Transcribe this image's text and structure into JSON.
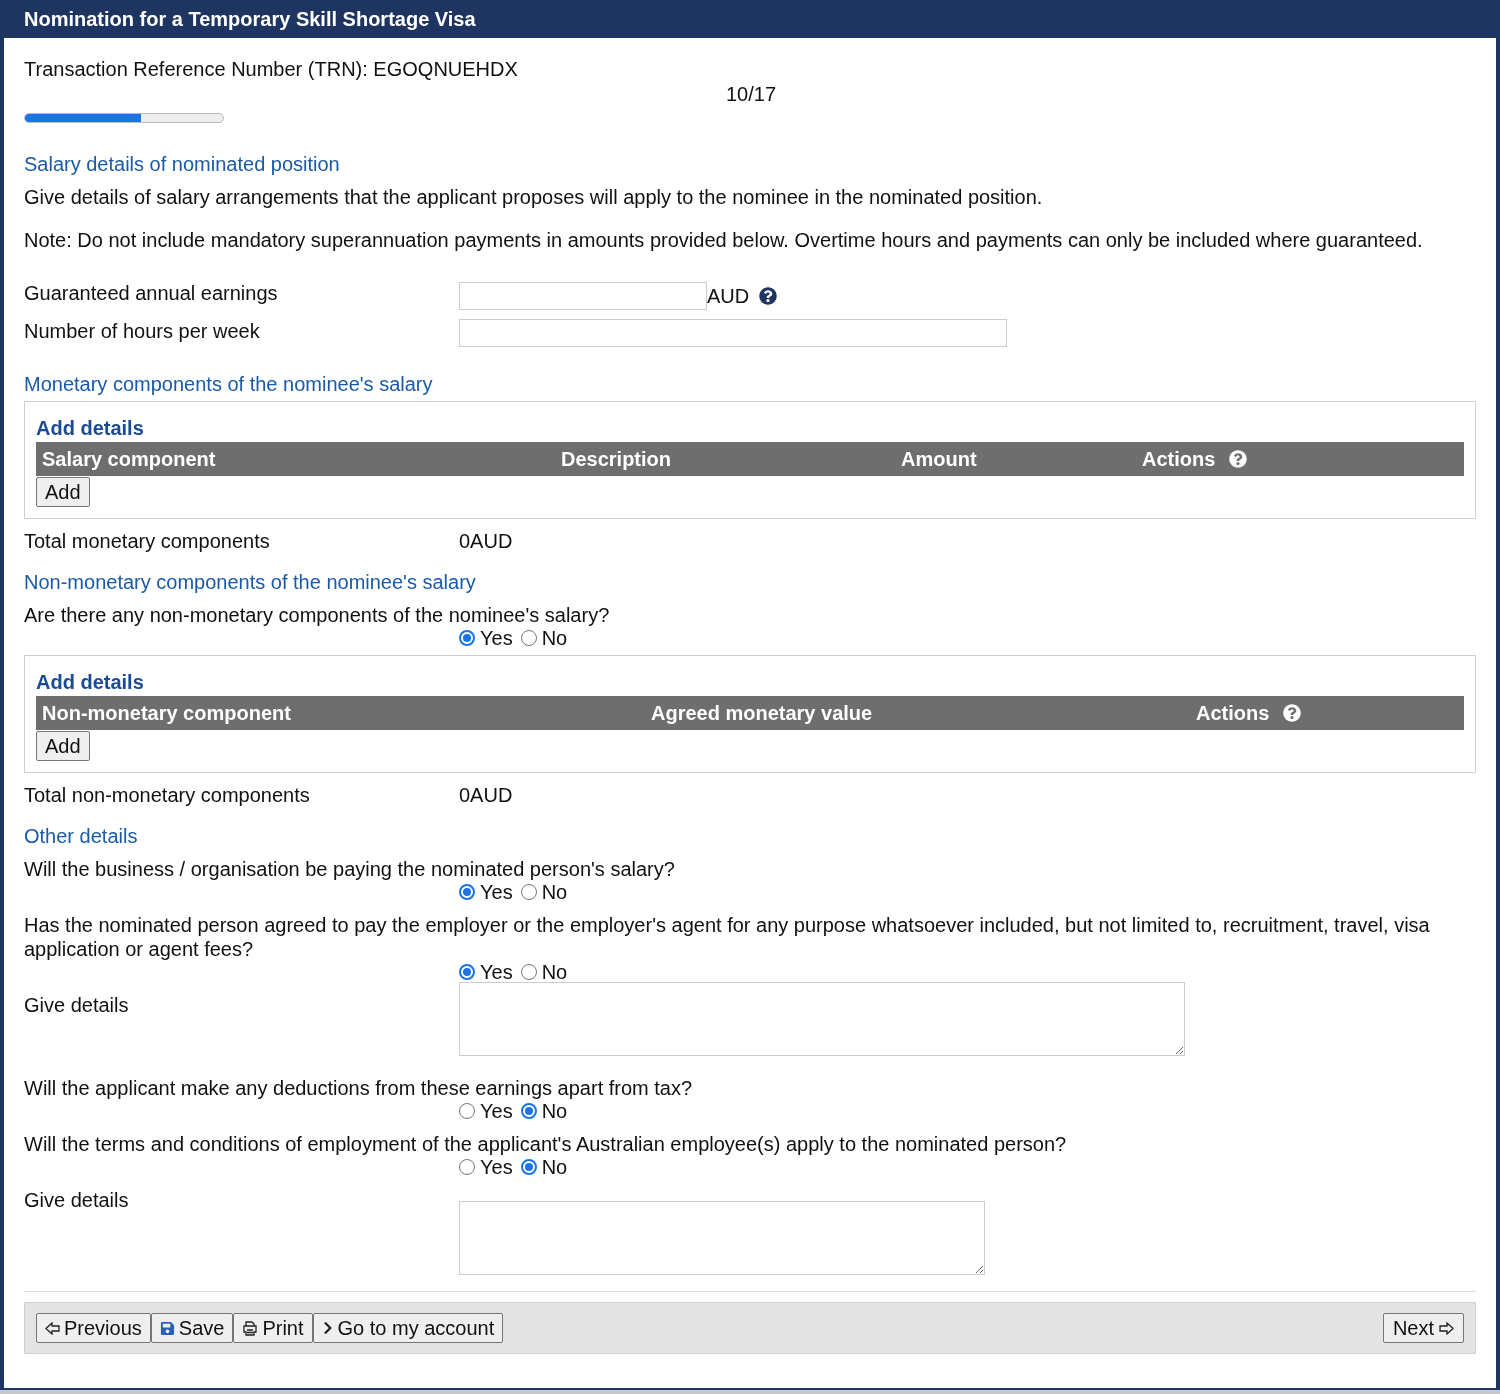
{
  "header": {
    "title": "Nomination for a Temporary Skill Shortage Visa"
  },
  "trn": "Transaction Reference Number (TRN): EGOQNUEHDX",
  "progress": {
    "label": "10/17",
    "level": 0.585
  },
  "blocks": [
    {
      "kind": "heading",
      "text": "Salary details of nominated position"
    },
    {
      "kind": "paragraph",
      "text": "Give details of salary arrangements that the applicant proposes will apply to the nominee in the nominated position."
    },
    {
      "kind": "paragraph",
      "text": "Note: Do not include mandatory superannuation payments in amounts provided below. Overtime hours and payments can only be included where guaranteed."
    },
    {
      "kind": "field",
      "label": "Guaranteed annual earnings",
      "suffix": "AUD",
      "help": true
    },
    {
      "kind": "field",
      "label": "Number of hours per week",
      "help": false
    },
    {
      "kind": "heading",
      "text": "Monetary components of the nominee's salary"
    },
    {
      "kind": "table",
      "title": "Add details",
      "columns": [
        "Salary component",
        "Description",
        "Amount",
        "Actions"
      ],
      "add": "Add"
    },
    {
      "kind": "total",
      "label": "Total monetary components",
      "value": "0AUD"
    },
    {
      "kind": "heading",
      "text": "Non-monetary components of the nominee's salary"
    },
    {
      "kind": "radio",
      "question": "Are there any non-monetary components of the nominee's salary?",
      "options": [
        {
          "label": "Yes",
          "selected": true
        },
        {
          "label": "No",
          "selected": false
        }
      ]
    },
    {
      "kind": "table",
      "title": "Add details",
      "columns": [
        "Non-monetary component",
        "Agreed monetary value",
        "Actions"
      ],
      "add": "Add"
    },
    {
      "kind": "total",
      "label": "Total non-monetary components",
      "value": "0AUD"
    },
    {
      "kind": "heading",
      "text": "Other details"
    },
    {
      "kind": "radio",
      "question": "Will the business / organisation be paying the nominated person's salary?",
      "options": [
        {
          "label": "Yes",
          "selected": true
        },
        {
          "label": "No",
          "selected": false
        }
      ]
    },
    {
      "kind": "radio",
      "question": "Has the nominated person agreed to pay the employer or the employer's agent for any purpose whatsoever included, but not limited to, recruitment, travel, visa application or agent fees?",
      "options": [
        {
          "label": "Yes",
          "selected": true
        },
        {
          "label": "No",
          "selected": false
        }
      ]
    },
    {
      "kind": "textarea",
      "label": "Give details",
      "wide": true
    },
    {
      "kind": "radio",
      "question": "Will the applicant make any deductions from these earnings apart from tax?",
      "options": [
        {
          "label": "Yes",
          "selected": false
        },
        {
          "label": "No",
          "selected": true
        }
      ]
    },
    {
      "kind": "radio",
      "question": "Will the terms and conditions of employment of the applicant's Australian employee(s) apply to the nominated person?",
      "options": [
        {
          "label": "Yes",
          "selected": false
        },
        {
          "label": "No",
          "selected": true
        }
      ]
    },
    {
      "kind": "textarea",
      "label": "Give details",
      "wide": false
    }
  ],
  "footer": {
    "buttons": [
      {
        "label": "Previous"
      },
      {
        "label": "Save"
      },
      {
        "label": "Print"
      },
      {
        "label": "Go to my account"
      }
    ],
    "next": {
      "label": "Next"
    }
  }
}
